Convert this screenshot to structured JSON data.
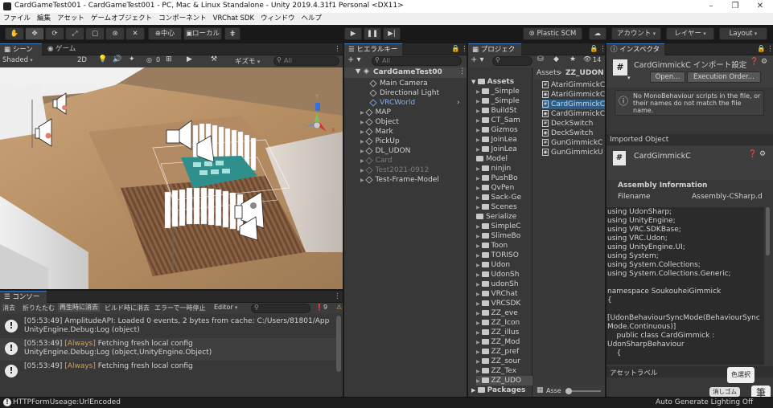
{
  "window": {
    "title": "CardGameTest001 - CardGameTest001 - PC, Mac & Linux Standalone - Unity 2019.4.31f1 Personal <DX11>",
    "controls": [
      "–",
      "❐",
      "✕"
    ]
  },
  "menu": [
    "ファイル",
    "編集",
    "アセット",
    "ゲームオブジェクト",
    "コンポーネント",
    "VRChat SDK",
    "ウィンドウ",
    "ヘルプ"
  ],
  "toolbar": {
    "pivot": "中心",
    "space": "ローカル",
    "plastic": "Plastic SCM",
    "account": "アカウント",
    "layers": "レイヤー",
    "layout": "Layout"
  },
  "scene": {
    "tabs": [
      "シーン",
      "ゲーム"
    ],
    "shading": "Shaded",
    "mode2d": "2D",
    "hidden_count": "0",
    "gizmos": "ギズモ",
    "search_placeholder": "All",
    "axis_x": "X",
    "axis_y": "Y",
    "axis_z": "Z"
  },
  "console": {
    "tab": "コンソール",
    "buttons": [
      "消去",
      "折りたたむ",
      "再生時に消去",
      "ビルド時に消去",
      "エラーで一時停止"
    ],
    "editor": "Editor",
    "info_count": "9",
    "logs": [
      {
        "line1": "[05:53:49] AmplitudeAPI: Loaded 0 events, 2 bytes from cache: C:/Users/81801/App",
        "line2": "UnityEngine.Debug:Log (object)"
      },
      {
        "pre": "[05:53:49] ",
        "tag": "[Always]",
        "post": " Fetching fresh local config",
        "line2": "UnityEngine.Debug:Log (object,UnityEngine.Object)"
      },
      {
        "pre": "[05:53:49] ",
        "tag": "[Always]",
        "post": " Fetching fresh local config",
        "line2": ""
      }
    ]
  },
  "hierarchy": {
    "tab": "ヒエラルキー",
    "search_placeholder": "All",
    "scene_root": "CardGameTest00",
    "items": [
      {
        "label": "Main Camera",
        "indent": 2,
        "state": "normal"
      },
      {
        "label": "Directional Light",
        "indent": 2,
        "state": "normal"
      },
      {
        "label": "VRCWorld",
        "indent": 2,
        "state": "prefab"
      },
      {
        "label": "MAP",
        "indent": 1,
        "state": "normal"
      },
      {
        "label": "Object",
        "indent": 1,
        "state": "normal"
      },
      {
        "label": "Mark",
        "indent": 1,
        "state": "normal"
      },
      {
        "label": "PickUp",
        "indent": 1,
        "state": "normal"
      },
      {
        "label": "DL_UDON",
        "indent": 1,
        "state": "normal"
      },
      {
        "label": "Card",
        "indent": 1,
        "state": "disabled"
      },
      {
        "label": "Test2021-0912",
        "indent": 1,
        "state": "disabled"
      },
      {
        "label": "Test-Frame-Model",
        "indent": 1,
        "state": "normal"
      }
    ]
  },
  "project": {
    "tab": "プロジェクト",
    "assets_root": "Assets",
    "folders": [
      "_Simple",
      "_Simple",
      "BuildSt",
      "CT_Sam",
      "Gizmos",
      "JoinLea",
      "JoinLea",
      "Model",
      "ninjin",
      "PushBo",
      "QvPen",
      "Sack-Ge",
      "Scenes",
      "Serialize",
      "SimpleC",
      "SlimeBo",
      "Toon",
      "TORISO",
      "Udon",
      "UdonSh",
      "udonSh",
      "VRChat",
      "VRCSDK",
      "ZZ_eve",
      "ZZ_Icon",
      "ZZ_illus",
      "ZZ_Mod",
      "ZZ_pref",
      "ZZ_sour",
      "ZZ_Tex",
      "ZZ_UDO"
    ],
    "packages": "Packages",
    "count": "14",
    "breadcrumb_root": "Assets",
    "breadcrumb_sep": "›",
    "breadcrumb_current": "ZZ_UDON",
    "files": [
      "AtariGimmickC",
      "AtariGimmickC",
      "CardGimmickC",
      "CardGimmickC",
      "DeckSwitch",
      "DeckSwitch",
      "GunGimmickC",
      "GunGimmickU"
    ],
    "bottom_path": "Asse"
  },
  "inspector": {
    "tab": "インスペクター",
    "title": "CardGimmickC インポート設定",
    "open_btn": "Open...",
    "exec_btn": "Execution Order...",
    "info": "No MonoBehaviour scripts in the file, or their names do not match the file name.",
    "imported": "Imported Object",
    "component": "CardGimmickC",
    "assembly_header": "Assembly Information",
    "filename_label": "Filename",
    "filename_value": "Assembly-CSharp.d",
    "code": "using UdonSharp;\nusing UnityEngine;\nusing VRC.SDKBase;\nusing VRC.Udon;\nusing UnityEngine.UI;\nusing System;\nusing System.Collections;\nusing System.Collections.Generic;\n\nnamespace SoukouheiGimmick\n{\n\n[UdonBehaviourSyncMode(BehaviourSync\nMode.Continuous)]\n    public class CardGimmick :\nUdonSharpBehaviour\n    {",
    "asset_label": "アセットラベル",
    "ime1": "色選択",
    "ime2": "消しゴム",
    "ime3": "筆"
  },
  "status": {
    "message": "HTTPFormUseage:UrlEncoded",
    "right": "Auto Generate Lighting Off"
  },
  "colors": {
    "accent": "#3a79bb",
    "prefab": "#7bb0ff",
    "warning": "#e0a040"
  }
}
